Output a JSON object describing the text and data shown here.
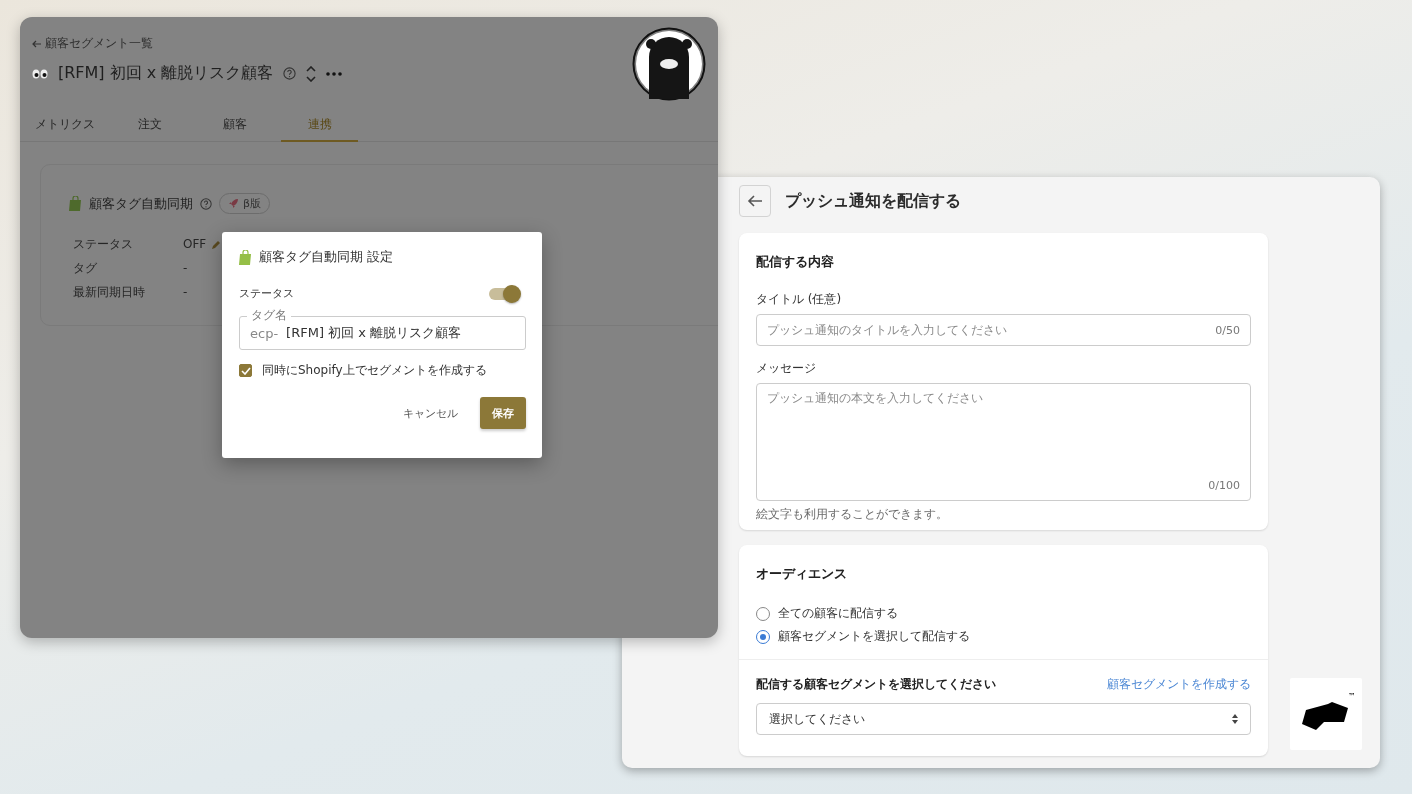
{
  "segment_window": {
    "back_link": "顧客セグメント一覧",
    "title": "[RFM] 初回 x 離脱リスク顧客",
    "tabs": [
      {
        "label": "メトリクス",
        "selected": false
      },
      {
        "label": "注文",
        "selected": false
      },
      {
        "label": "顧客",
        "selected": false
      },
      {
        "label": "連携",
        "selected": true
      }
    ],
    "sync_card": {
      "title": "顧客タグ自動同期",
      "badge": "β版",
      "rows": [
        {
          "label": "ステータス",
          "value": "OFF",
          "editable": true
        },
        {
          "label": "タグ",
          "value": "-",
          "editable": false
        },
        {
          "label": "最新同期日時",
          "value": "-",
          "editable": false
        }
      ]
    }
  },
  "tag_dialog": {
    "title": "顧客タグ自動同期 設定",
    "status_label": "ステータス",
    "status_on": true,
    "tag_field": {
      "label": "タグ名",
      "prefix": "ecp-",
      "value": "[RFM] 初回 x 離脱リスク顧客"
    },
    "checkbox": {
      "label": "同時にShopify上でセグメントを作成する",
      "checked": true
    },
    "buttons": [
      {
        "label": "キャンセル",
        "kind": "text"
      },
      {
        "label": "保存",
        "kind": "primary"
      }
    ]
  },
  "push_window": {
    "title": "プッシュ通知を配信する",
    "content_card": {
      "heading": "配信する内容",
      "title_field": {
        "label": "タイトル (任意)",
        "placeholder": "プッシュ通知のタイトルを入力してください",
        "counter": "0/50"
      },
      "message_field": {
        "label": "メッセージ",
        "placeholder": "プッシュ通知の本文を入力してください",
        "counter": "0/100"
      },
      "hint": "絵文字も利用することができます。"
    },
    "audience_card": {
      "heading": "オーディエンス",
      "options": [
        {
          "label": "全ての顧客に配信する",
          "selected": false
        },
        {
          "label": "顧客セグメントを選択して配信する",
          "selected": true
        }
      ],
      "segment_label": "配信する顧客セグメントを選択してください",
      "create_link": "顧客セグメントを作成する",
      "select_value": "選択してください"
    },
    "logo_mark": "™"
  }
}
